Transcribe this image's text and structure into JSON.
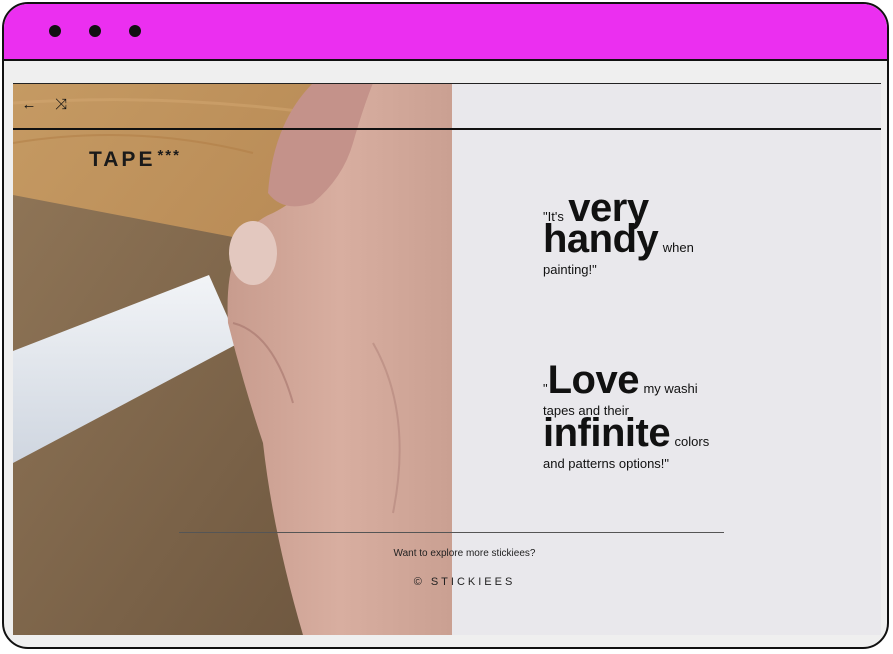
{
  "window": {
    "controls": [
      "dot",
      "dot",
      "dot"
    ],
    "titlebar_color": "#eb2ff0"
  },
  "nav": {
    "back_icon": "arrow-left-icon",
    "back_glyph": "←",
    "shuffle_icon": "shuffle-icon",
    "shuffle_glyph": "⤨"
  },
  "brand": {
    "name": "TAPE",
    "stars": "***"
  },
  "quotes": [
    {
      "open": "\"It's",
      "big1": "very",
      "big2": "handy",
      "mid": "when",
      "end": "painting!\""
    },
    {
      "open": "\"",
      "big1": "Love",
      "mid1": "my washi",
      "line2": "tapes and their",
      "big2": "infinite",
      "mid2": "colors",
      "end": "and patterns options!\""
    }
  ],
  "footer": {
    "explore": "Want to explore more stickiees?",
    "copyright": "© STICKIEES"
  },
  "colors": {
    "panel": "#e9e8ec",
    "text": "#111111"
  }
}
